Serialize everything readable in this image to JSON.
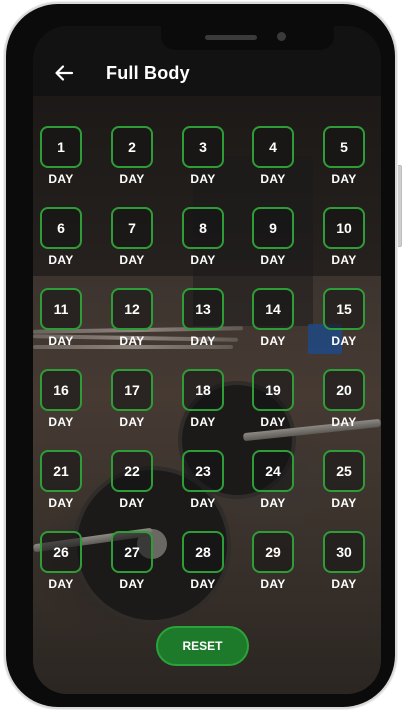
{
  "header": {
    "title": "Full Body",
    "back_icon": "arrow-left-icon"
  },
  "days": [
    {
      "number": "1",
      "label": "DAY"
    },
    {
      "number": "2",
      "label": "DAY"
    },
    {
      "number": "3",
      "label": "DAY"
    },
    {
      "number": "4",
      "label": "DAY"
    },
    {
      "number": "5",
      "label": "DAY"
    },
    {
      "number": "6",
      "label": "DAY"
    },
    {
      "number": "7",
      "label": "DAY"
    },
    {
      "number": "8",
      "label": "DAY"
    },
    {
      "number": "9",
      "label": "DAY"
    },
    {
      "number": "10",
      "label": "DAY"
    },
    {
      "number": "11",
      "label": "DAY"
    },
    {
      "number": "12",
      "label": "DAY"
    },
    {
      "number": "13",
      "label": "DAY"
    },
    {
      "number": "14",
      "label": "DAY"
    },
    {
      "number": "15",
      "label": "DAY"
    },
    {
      "number": "16",
      "label": "DAY"
    },
    {
      "number": "17",
      "label": "DAY"
    },
    {
      "number": "18",
      "label": "DAY"
    },
    {
      "number": "19",
      "label": "DAY"
    },
    {
      "number": "20",
      "label": "DAY"
    },
    {
      "number": "21",
      "label": "DAY"
    },
    {
      "number": "22",
      "label": "DAY"
    },
    {
      "number": "23",
      "label": "DAY"
    },
    {
      "number": "24",
      "label": "DAY"
    },
    {
      "number": "25",
      "label": "DAY"
    },
    {
      "number": "26",
      "label": "DAY"
    },
    {
      "number": "27",
      "label": "DAY"
    },
    {
      "number": "28",
      "label": "DAY"
    },
    {
      "number": "29",
      "label": "DAY"
    },
    {
      "number": "30",
      "label": "DAY"
    }
  ],
  "reset_label": "RESET",
  "colors": {
    "accent_green": "#2e9d38",
    "button_green": "#1e7a2b",
    "app_bar": "#121212"
  }
}
